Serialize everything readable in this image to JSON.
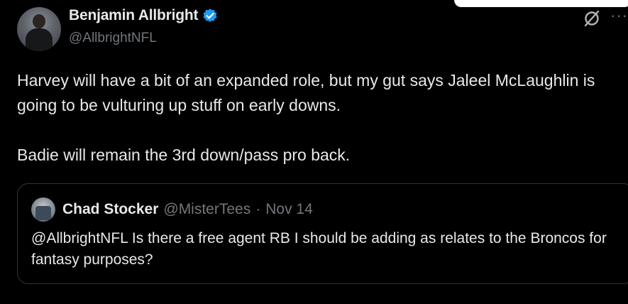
{
  "author": {
    "display_name": "Benjamin Allbright",
    "handle": "@AllbrightNFL",
    "verified": true
  },
  "tweet": {
    "paragraphs": [
      "Harvey will have a bit of an expanded role, but my gut says Jaleel McLaughlin is going to be vulturing up stuff on early downs.",
      "Badie will remain the 3rd down/pass pro back."
    ]
  },
  "quoted_tweet": {
    "display_name": "Chad Stocker",
    "handle": "@MisterTees",
    "separator": "·",
    "date": "Nov 14",
    "text": "@AllbrightNFL Is there a free agent RB I should be adding as relates to the Broncos for fantasy purposes?"
  },
  "icons": {
    "verified": "verified-badge-icon",
    "grok": "grok-icon",
    "more": "more-icon"
  },
  "colors": {
    "background": "#000000",
    "text_primary": "#e7e9ea",
    "text_secondary": "#71767b",
    "verified_blue": "#1d9bf0",
    "border": "#2f3336"
  }
}
